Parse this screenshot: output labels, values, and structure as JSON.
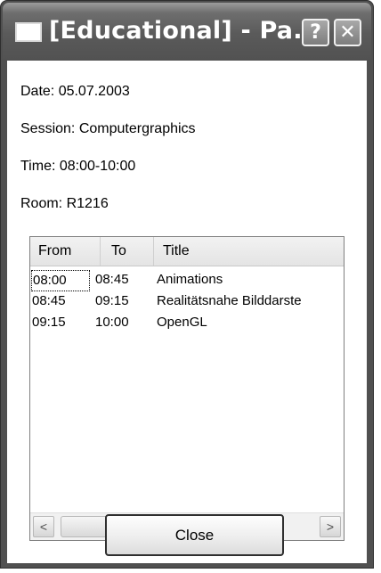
{
  "window": {
    "title": "[Educational] - Pa...",
    "help_glyph": "?",
    "close_glyph": "✕"
  },
  "info": {
    "date": "Date: 05.07.2003",
    "session": "Session: Computergraphics",
    "time": "Time: 08:00-10:00",
    "room": "Room: R1216"
  },
  "table": {
    "columns": [
      "From",
      "To",
      "Title"
    ],
    "rows": [
      {
        "from": "08:00",
        "to": "08:45",
        "title": "Animations"
      },
      {
        "from": "08:45",
        "to": "09:15",
        "title": "Realitätsnahe Bilddarste"
      },
      {
        "from": "09:15",
        "to": "10:00",
        "title": "OpenGL"
      }
    ]
  },
  "scrollbar": {
    "left_arrow": "<",
    "right_arrow": ">"
  },
  "buttons": {
    "close_label": "Close"
  }
}
